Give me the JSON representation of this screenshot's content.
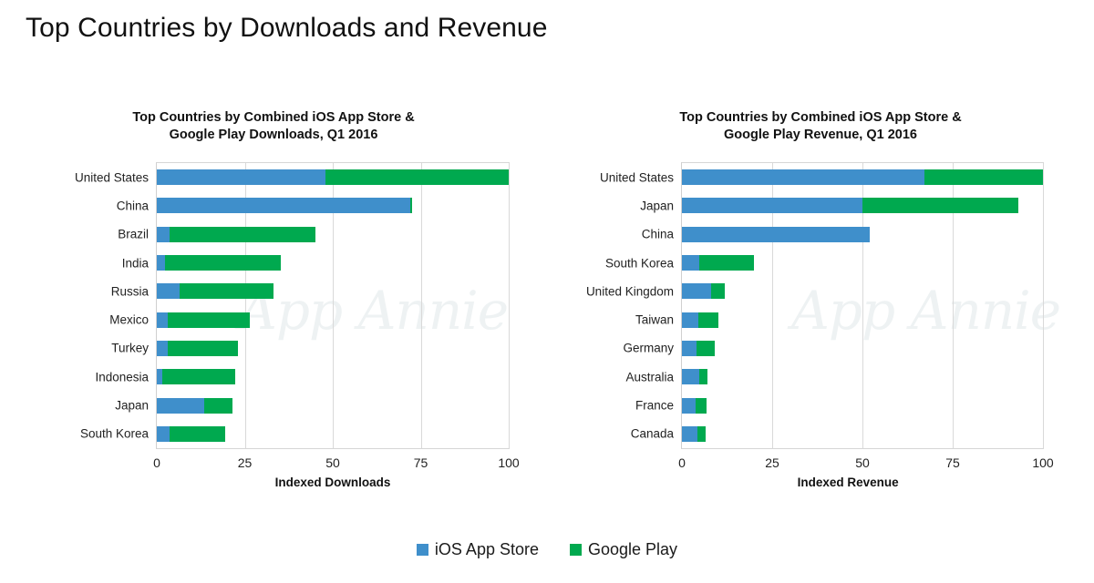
{
  "page": {
    "title": "Top Countries by Downloads and Revenue",
    "watermark": "App Annie"
  },
  "legend": {
    "items": [
      {
        "label": "iOS App Store",
        "color": "#3f8fcb",
        "key": "ios-app-store"
      },
      {
        "label": "Google Play",
        "color": "#00a94f",
        "key": "google-play"
      }
    ]
  },
  "chart_data": [
    {
      "type": "bar",
      "orientation": "horizontal",
      "stacked": true,
      "id": "downloads",
      "title": "Top Countries by Combined iOS App Store & Google Play Downloads, Q1 2016",
      "title_lines": [
        "Top Countries by Combined iOS App Store &",
        "Google Play Downloads, Q1 2016"
      ],
      "xlabel": "Indexed Downloads",
      "ylabel": "",
      "xlim": [
        0,
        100
      ],
      "xticks": [
        0,
        25,
        50,
        75,
        100
      ],
      "xtick_labels": [
        "0",
        "25",
        "50",
        "75",
        "100"
      ],
      "grid": "vertical",
      "legend_position": "bottom",
      "categories": [
        "United States",
        "China",
        "Brazil",
        "India",
        "Russia",
        "Mexico",
        "Turkey",
        "Indonesia",
        "Japan",
        "South Korea"
      ],
      "series": [
        {
          "name": "iOS App Store",
          "color": "#3f8fcb",
          "values": [
            48,
            72,
            3.5,
            2.4,
            6.5,
            3,
            3.2,
            1.5,
            13.5,
            3.6
          ]
        },
        {
          "name": "Google Play",
          "color": "#00a94f",
          "values": [
            52,
            0.5,
            41.5,
            32.9,
            26.7,
            23.5,
            19.9,
            20.9,
            8.1,
            15.9
          ]
        }
      ],
      "totals": [
        100,
        72.5,
        45,
        35.3,
        33.2,
        26.5,
        23.1,
        22.4,
        21.6,
        19.5
      ]
    },
    {
      "type": "bar",
      "orientation": "horizontal",
      "stacked": true,
      "id": "revenue",
      "title": "Top Countries by Combined iOS App Store & Google Play Revenue, Q1 2016",
      "title_lines": [
        "Top Countries by Combined iOS App Store &",
        "Google Play Revenue, Q1 2016"
      ],
      "xlabel": "Indexed Revenue",
      "ylabel": "",
      "xlim": [
        0,
        100
      ],
      "xticks": [
        0,
        25,
        50,
        75,
        100
      ],
      "xtick_labels": [
        "0",
        "25",
        "50",
        "75",
        "100"
      ],
      "grid": "vertical",
      "legend_position": "bottom",
      "categories": [
        "United States",
        "Japan",
        "China",
        "South Korea",
        "United Kingdom",
        "Taiwan",
        "Germany",
        "Australia",
        "France",
        "Canada"
      ],
      "series": [
        {
          "name": "iOS App Store",
          "color": "#3f8fcb",
          "values": [
            67.2,
            50.1,
            52,
            4.7,
            8.1,
            4.6,
            4,
            4.7,
            3.9,
            4.2
          ]
        },
        {
          "name": "Google Play",
          "color": "#00a94f",
          "values": [
            32.8,
            43.1,
            0,
            15.2,
            3.7,
            5.5,
            5.1,
            2.3,
            2.8,
            2.4
          ]
        }
      ],
      "totals": [
        100,
        93.2,
        52,
        19.9,
        11.8,
        10.1,
        9.1,
        7.0,
        6.7,
        6.6
      ]
    }
  ]
}
